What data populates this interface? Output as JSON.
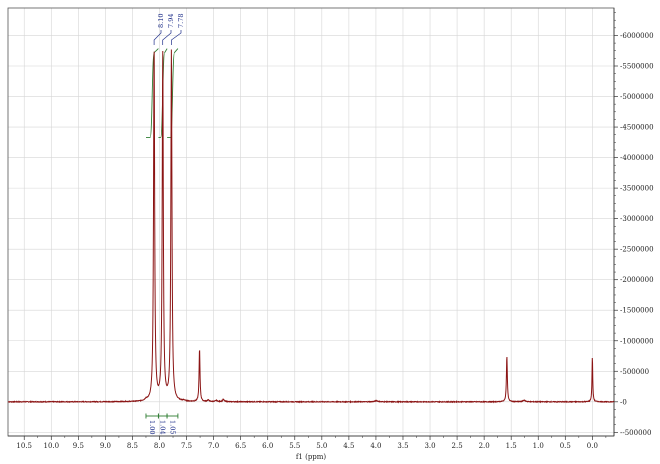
{
  "chart_data": {
    "type": "line",
    "xlabel": "f1 (ppm)",
    "ylabel": "",
    "xlim": [
      10.8,
      -0.4
    ],
    "ylim": [
      -560000,
      6450000
    ],
    "x_ticks": [
      10.5,
      10.0,
      9.5,
      9.0,
      8.5,
      8.0,
      7.5,
      7.0,
      6.5,
      6.0,
      5.5,
      5.0,
      4.5,
      4.0,
      3.5,
      3.0,
      2.5,
      2.0,
      1.5,
      1.0,
      0.5,
      0.0
    ],
    "x_tick_labels": [
      "10.5",
      "10.0",
      "9.5",
      "9.0",
      "8.5",
      "8.0",
      "7.5",
      "7.0",
      "6.5",
      "6.0",
      "5.5",
      "5.0",
      "4.5",
      "4.0",
      "3.5",
      "3.0",
      "2.5",
      "2.0",
      "1.5",
      "1.0",
      "0.5",
      "0.0"
    ],
    "y_ticks": [
      -500000,
      0,
      500000,
      1000000,
      1500000,
      2000000,
      2500000,
      3000000,
      3500000,
      4000000,
      4500000,
      5000000,
      5500000,
      6000000
    ],
    "y_tick_labels": [
      "-500000",
      "0",
      "500000",
      "1000000",
      "1500000",
      "2000000",
      "2500000",
      "3000000",
      "3500000",
      "4000000",
      "4500000",
      "5000000",
      "5500000",
      "6000000"
    ],
    "grid": true,
    "line_color": "#8b1414",
    "integral_color": "#2e7d32",
    "label_color": "#1f2f8a",
    "peaks": [
      {
        "ppm": 8.1,
        "height": 5850000,
        "width": 0.012
      },
      {
        "ppm": 7.94,
        "height": 5700000,
        "width": 0.012
      },
      {
        "ppm": 7.78,
        "height": 5750000,
        "width": 0.012
      },
      {
        "ppm": 7.26,
        "height": 870000,
        "width": 0.01
      },
      {
        "ppm": 1.58,
        "height": 750000,
        "width": 0.01
      },
      {
        "ppm": 0.0,
        "height": 740000,
        "width": 0.008
      },
      {
        "ppm": 3.99,
        "height": 20000,
        "width": 0.03
      },
      {
        "ppm": 1.26,
        "height": 25000,
        "width": 0.03
      },
      {
        "ppm": 7.1,
        "height": 25000,
        "width": 0.02
      },
      {
        "ppm": 6.95,
        "height": 20000,
        "width": 0.02
      },
      {
        "ppm": 6.82,
        "height": 35000,
        "width": 0.02
      },
      {
        "ppm": 8.25,
        "height": 25000,
        "width": 0.02
      },
      {
        "ppm": 7.55,
        "height": 15000,
        "width": 0.02
      }
    ],
    "peak_labels": [
      {
        "ppm": 8.1,
        "text": "8.10"
      },
      {
        "ppm": 7.94,
        "text": "7.94"
      },
      {
        "ppm": 7.78,
        "text": "7.78"
      }
    ],
    "integrals": [
      {
        "from": 8.25,
        "to": 8.02,
        "value": "1.00"
      },
      {
        "from": 8.02,
        "to": 7.86,
        "value": "1.04"
      },
      {
        "from": 7.86,
        "to": 7.66,
        "value": "1.05"
      }
    ]
  }
}
